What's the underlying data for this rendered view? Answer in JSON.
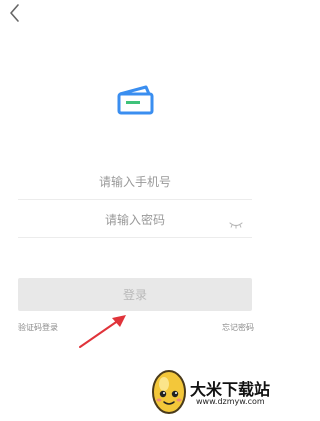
{
  "nav": {
    "back_icon": "chevron-left-icon"
  },
  "logo": {
    "icon": "folder-logo-icon",
    "colors": {
      "blue": "#3a8ef0",
      "green": "#3fc27a"
    }
  },
  "form": {
    "phone_placeholder": "请输入手机号",
    "password_placeholder": "请输入密码",
    "eye_icon": "eye-closed-icon"
  },
  "actions": {
    "login_label": "登录",
    "code_login_label": "验证码登录",
    "forgot_password_label": "忘记密码"
  },
  "annotation": {
    "color": "#e0333a"
  },
  "watermark": {
    "title": "大米下载站",
    "url": "www.dzmyw.com"
  }
}
